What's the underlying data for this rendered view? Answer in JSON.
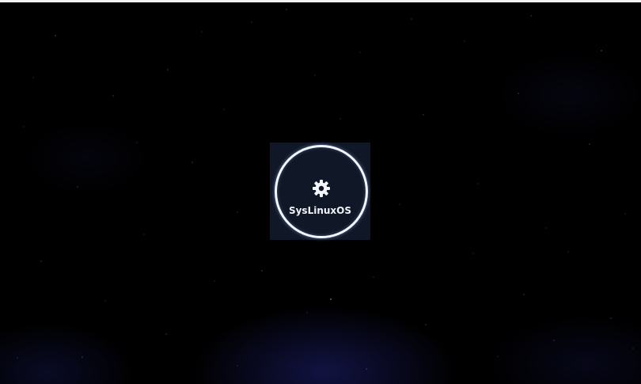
{
  "boot_screen": {
    "os_name": "SysLinuxOS",
    "icon": "gear-icon",
    "colors": {
      "background": "#000000",
      "ring": "#f2f6ff",
      "text": "#f0f2f6",
      "glow": "#20227a"
    }
  }
}
